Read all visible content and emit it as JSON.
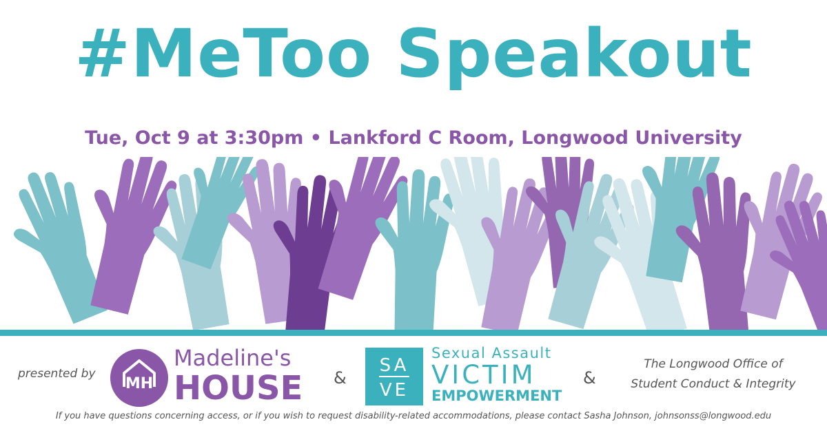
{
  "colors": {
    "teal": "#3bb1be",
    "purple": "#8a56a8",
    "gray_text": "#555555",
    "hand_palette": [
      "#7cc0c9",
      "#9b6dbb",
      "#a7cfd7",
      "#b89bd0",
      "#6c3d91",
      "#d2e6eb",
      "#9567b1"
    ]
  },
  "header": {
    "title": "#MeToo Speakout",
    "event_line": "Tue, Oct 9 at 3:30pm • Lankford C Room, Longwood University"
  },
  "sponsors": {
    "presented_by": "presented by",
    "ampersand": "&",
    "madelines_house": {
      "line1": "Madeline's",
      "line2": "HOUSE",
      "logo_letters": "MH"
    },
    "save": {
      "logo_top": "SA",
      "logo_bottom": "VE",
      "line1": "Sexual Assault",
      "line2": "VICTIM",
      "line3": "EMPOWERMENT"
    },
    "office": {
      "line1": "The Longwood Office of",
      "line2": "Student Conduct & Integrity"
    }
  },
  "footer_note": "If you have questions concerning access, or if you wish to request disability-related accommodations, please contact Sasha Johnson, johnsonss@longwood.edu",
  "illustration": {
    "icon": "raised-hands-illustration",
    "hand_count": 17
  }
}
